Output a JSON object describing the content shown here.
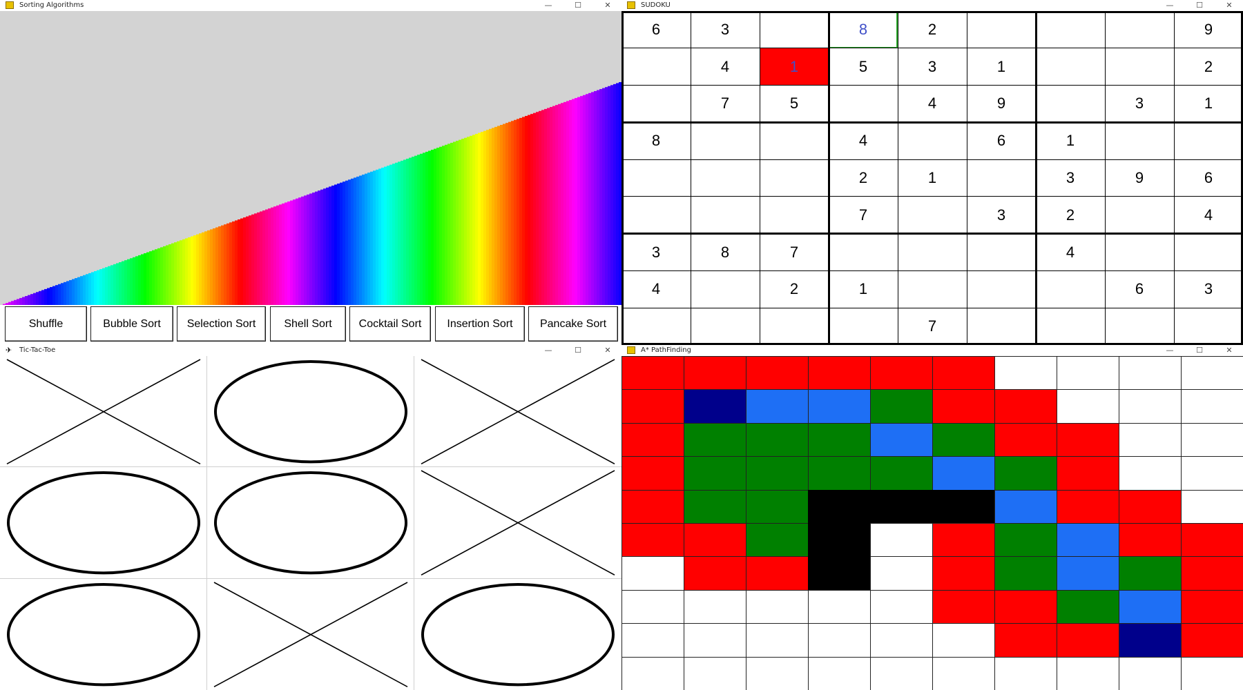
{
  "colors": {
    "red": "#ff0000",
    "green": "#008000",
    "blue": "#1e6ff5",
    "navy": "#00008b",
    "black": "#000000",
    "white": "#ffffff",
    "sort_bg": "#d3d3d3",
    "sudoku_highlight": "#ff0000",
    "sudoku_select": "#2fae2f",
    "sudoku_user_digit": "#4050c8"
  },
  "window_controls": {
    "minimize": "—",
    "maximize": "☐",
    "close": "✕"
  },
  "sorting": {
    "title": "Sorting Algorithms",
    "icon": "python-feather-icon",
    "bars_state": "rainbow ascending (sorted)",
    "buttons": [
      "Shuffle",
      "Bubble Sort",
      "Selection Sort",
      "Shell Sort",
      "Cocktail Sort",
      "Insertion Sort",
      "Pancake Sort"
    ]
  },
  "sudoku": {
    "title": "SUDOKU",
    "icon": "python-feather-icon",
    "grid": [
      [
        "6",
        "3",
        "",
        "8",
        "2",
        "",
        "",
        "",
        "9"
      ],
      [
        "",
        "4",
        "1",
        "5",
        "3",
        "1",
        "",
        "",
        "2"
      ],
      [
        "",
        "7",
        "5",
        "",
        "4",
        "9",
        "",
        "3",
        "1"
      ],
      [
        "8",
        "",
        "",
        "4",
        "",
        "6",
        "1",
        "",
        ""
      ],
      [
        "",
        "",
        "",
        "2",
        "1",
        "",
        "3",
        "9",
        "6"
      ],
      [
        "",
        "",
        "",
        "7",
        "",
        "3",
        "2",
        "",
        "4"
      ],
      [
        "3",
        "8",
        "7",
        "",
        "",
        "",
        "4",
        "",
        ""
      ],
      [
        "4",
        "",
        "2",
        "1",
        "",
        "",
        "",
        "6",
        "3"
      ],
      [
        "",
        "",
        "",
        "",
        "7",
        "",
        "",
        "",
        ""
      ]
    ],
    "selected_cell": [
      0,
      3
    ],
    "conflict_cell": [
      1,
      2
    ]
  },
  "tictactoe": {
    "title": "Tic-Tac-Toe",
    "icon": "tk-feather-icon",
    "board": [
      [
        "X",
        "O",
        "X"
      ],
      [
        "O",
        "O",
        "X"
      ],
      [
        "O",
        "X",
        "O"
      ]
    ]
  },
  "astar": {
    "title": "A* PathFinding",
    "icon": "python-feather-icon",
    "legend": {
      "R": "closed",
      "G": "open",
      "B": "path",
      "N": "endpoint",
      "K": "wall",
      "W": "empty"
    },
    "grid": [
      "RRRRRRWWWW",
      "RNBBGRRWWW",
      "RGGGBGRRWW",
      "RGGGGBGRWW",
      "RGGKKKBRRW",
      "RRGKWRGBRR",
      "WRRKWRGBGR",
      "WWWWWRRGBR",
      "WWWWWWRRNR",
      "WWWWWWWWWW"
    ]
  }
}
